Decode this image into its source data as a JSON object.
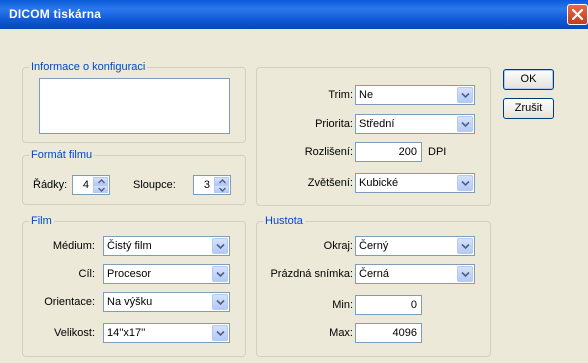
{
  "window": {
    "title": "DICOM tiskárna"
  },
  "config_info": {
    "label": "Informace o konfiguraci",
    "text": ""
  },
  "film_format": {
    "label": "Formát filmu",
    "rows_label": "Řádky:",
    "rows_value": "4",
    "cols_label": "Sloupce:",
    "cols_value": "3"
  },
  "film": {
    "label": "Film",
    "medium_label": "Médium:",
    "medium_value": "Čistý film",
    "target_label": "Cíl:",
    "target_value": "Procesor",
    "orientation_label": "Orientace:",
    "orientation_value": "Na výšku",
    "size_label": "Velikost:",
    "size_value": "14''x17''"
  },
  "print": {
    "trim_label": "Trim:",
    "trim_value": "Ne",
    "priority_label": "Priorita:",
    "priority_value": "Střední",
    "resolution_label": "Rozlišení:",
    "resolution_value": "200",
    "resolution_unit": "DPI",
    "magnification_label": "Zvětšení:",
    "magnification_value": "Kubické"
  },
  "density": {
    "label": "Hustota",
    "border_label": "Okraj:",
    "border_value": "Černý",
    "empty_label": "Prázdná snímka:",
    "empty_value": "Černá",
    "min_label": "Min:",
    "min_value": "0",
    "max_label": "Max:",
    "max_value": "4096"
  },
  "buttons": {
    "ok": "OK",
    "cancel": "Zrušit"
  }
}
